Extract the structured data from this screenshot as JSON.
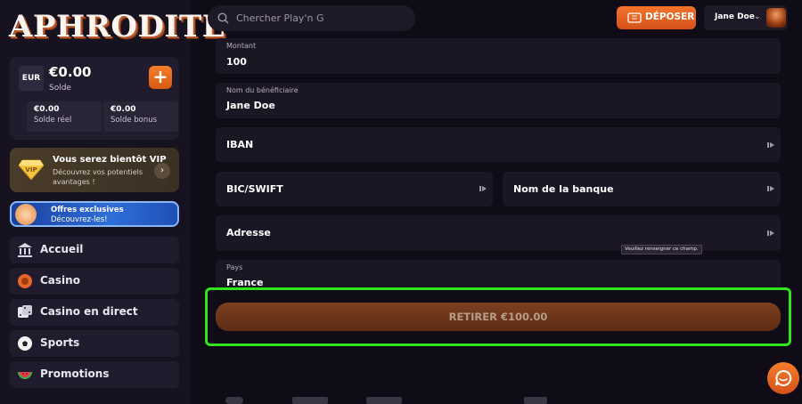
{
  "brand": {
    "logo_text": "APHRODITE"
  },
  "sidebar": {
    "balance": {
      "currency": "EUR",
      "amount": "€0.00",
      "label": "Solde",
      "real_amount": "€0.00",
      "real_label": "Solde réel",
      "bonus_amount": "€0.00",
      "bonus_label": "Solde bonus"
    },
    "vip": {
      "title": "Vous serez bientôt VIP",
      "description": "Découvrez vos potentiels avantages !",
      "badge": "VIP"
    },
    "offer": {
      "title": "Offres exclusives",
      "subtitle": "Découvrez-les!"
    },
    "nav": [
      {
        "label": "Accueil",
        "icon": "bank-icon"
      },
      {
        "label": "Casino",
        "icon": "chip-icon"
      },
      {
        "label": "Casino en direct",
        "icon": "dice-icon"
      },
      {
        "label": "Sports",
        "icon": "soccer-ball-icon"
      },
      {
        "label": "Promotions",
        "icon": "watermelon-icon"
      }
    ]
  },
  "header": {
    "search_placeholder": "Chercher Play'n G",
    "deposit_label": "DÉPOSER",
    "user_name": "Jane Doe"
  },
  "form": {
    "amount": {
      "label": "Montant",
      "value": "100"
    },
    "beneficiary": {
      "label": "Nom du bénéficiaire",
      "value": "Jane Doe"
    },
    "iban": {
      "placeholder": "IBAN"
    },
    "bic": {
      "placeholder": "BIC/SWIFT"
    },
    "bank_name": {
      "placeholder": "Nom de la banque"
    },
    "address": {
      "placeholder": "Adresse"
    },
    "country": {
      "label": "Pays",
      "value": "France"
    },
    "tooltip": "Veuillez renseigner ce champ.",
    "withdraw_label": "RETIRER €100.00"
  },
  "colors": {
    "accent": "#e8662a",
    "highlight": "#31e31c",
    "background": "#0f0c17",
    "panel": "#1a1624"
  }
}
